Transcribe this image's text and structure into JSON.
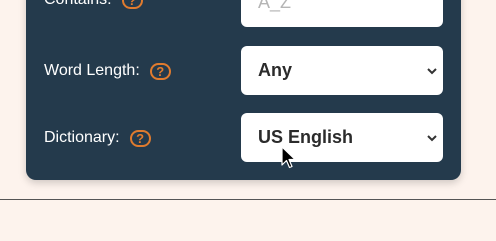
{
  "contains": {
    "label": "Contains:",
    "help": "?",
    "placeholder": "A_Z"
  },
  "word_length": {
    "label": "Word Length:",
    "help": "?",
    "value": "Any"
  },
  "dictionary": {
    "label": "Dictionary:",
    "help": "?",
    "value": "US English"
  },
  "colors": {
    "panel": "#243a4c",
    "accent": "#e07b2e",
    "page_bg": "#fdf3ed"
  }
}
